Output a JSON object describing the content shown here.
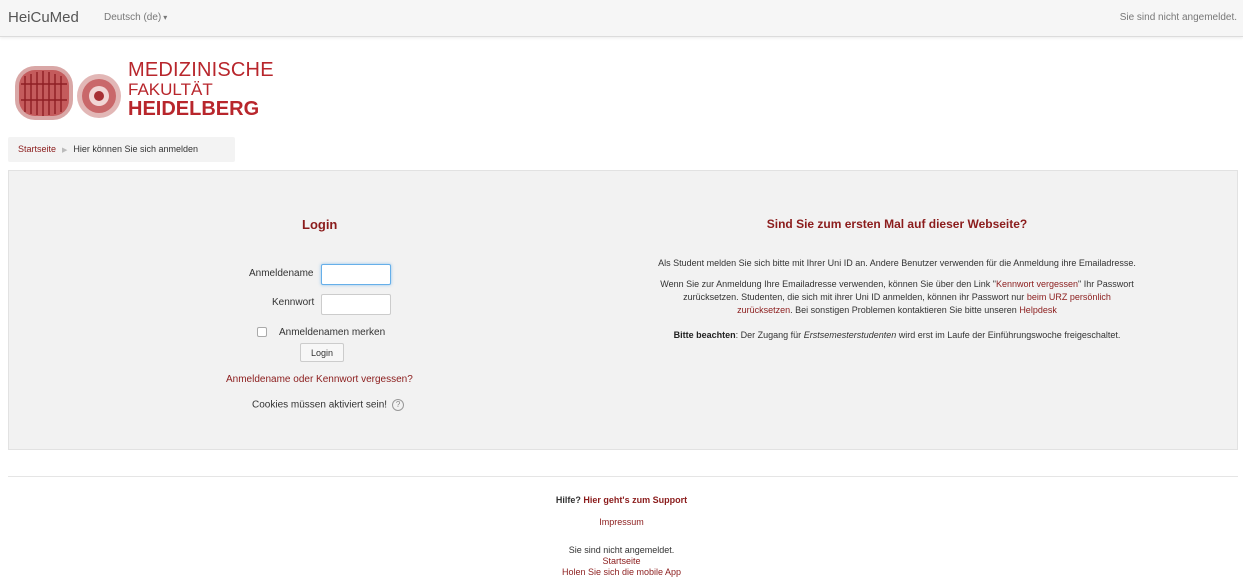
{
  "navbar": {
    "brand": "HeiCuMed",
    "language": "Deutsch (de)",
    "login_status": "Sie sind nicht angemeldet."
  },
  "logo": {
    "line1": "MEDIZINISCHE",
    "line2": "FAKULTÄT",
    "line3": "HEIDELBERG"
  },
  "breadcrumb": {
    "home": "Startseite",
    "current": "Hier können Sie sich anmelden"
  },
  "login": {
    "title": "Login",
    "username_label": "Anmeldename",
    "username_value": "",
    "password_label": "Kennwort",
    "password_value": "",
    "remember_label": "Anmeldenamen merken",
    "button_label": "Login",
    "forgot_link": "Anmeldename oder Kennwort vergessen?",
    "cookies_text": "Cookies müssen aktiviert sein!",
    "help_icon": "help-icon"
  },
  "info": {
    "title": "Sind Sie zum ersten Mal auf dieser Webseite?",
    "p1": "Als Student melden Sie sich bitte mit Ihrer Uni ID an. Andere Benutzer verwenden für die Anmeldung ihre Emailadresse.",
    "p2_a": "Wenn Sie zur Anmeldung Ihre Emailadresse verwenden, können Sie über den Link \"",
    "p2_link1": "Kennwort vergessen",
    "p2_b": "\" Ihr Passwort",
    "p2_c": "zurücksetzen. Studenten, die sich mit ihrer Uni ID anmelden, können ihr Passwort nur ",
    "p2_link2a": "beim URZ persönlich",
    "p2_link2b": "zurücksetzen",
    "p2_d": ". Bei sonstigen Problemen kontaktieren Sie bitte unseren ",
    "p2_link3": "Helpdesk",
    "p3_bold": "Bitte beachten",
    "p3_a": ": Der Zugang für ",
    "p3_italic": "Erstsemesterstudenten",
    "p3_b": " wird erst im Laufe der Einführungswoche freigeschaltet."
  },
  "footer": {
    "help_prefix": "Hilfe? ",
    "help_link": "Hier geht's zum Support",
    "impressum": "Impressum",
    "not_logged_in": "Sie sind nicht angemeldet.",
    "home_link": "Startseite",
    "mobile_app": "Holen Sie sich die mobile App"
  },
  "colors": {
    "accent": "#8b1c1c",
    "logo_red": "#b8262c",
    "panel_bg": "#f2f2f2"
  }
}
